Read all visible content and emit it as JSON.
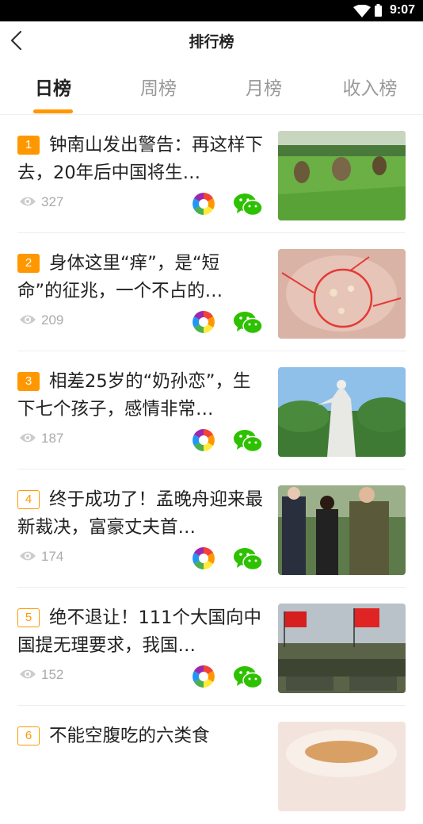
{
  "status_bar": {
    "time": "9:07"
  },
  "header": {
    "title": "排行榜"
  },
  "tabs": [
    {
      "label": "日榜",
      "active": true
    },
    {
      "label": "周榜",
      "active": false
    },
    {
      "label": "月榜",
      "active": false
    },
    {
      "label": "收入榜",
      "active": false
    }
  ],
  "colors": {
    "accent": "#ff9800",
    "wechat_green": "#2dc100",
    "muted": "#aaaaaa"
  },
  "articles": [
    {
      "rank": "1",
      "title": "钟南山发出警告：再这样下去，20年后中国将生…",
      "views": "327",
      "thumb_icon": "rice-field-thumbnail"
    },
    {
      "rank": "2",
      "title": "身体这里“痒”，是“短命”的征兆，一个不占的…",
      "views": "209",
      "thumb_icon": "skin-closeup-thumbnail"
    },
    {
      "rank": "3",
      "title": "相差25岁的“奶孙恋”，生下七个孩子，感情非常…",
      "views": "187",
      "thumb_icon": "statue-thumbnail"
    },
    {
      "rank": "4",
      "title": "终于成功了！孟晚舟迎来最新裁决，富豪丈夫首…",
      "views": "174",
      "thumb_icon": "people-walking-thumbnail"
    },
    {
      "rank": "5",
      "title": "绝不退让！111个大国向中国提无理要求，我国…",
      "views": "152",
      "thumb_icon": "military-parade-thumbnail"
    },
    {
      "rank": "6",
      "title": "不能空腹吃的六类食",
      "views": "",
      "thumb_icon": "food-bowl-thumbnail"
    }
  ]
}
